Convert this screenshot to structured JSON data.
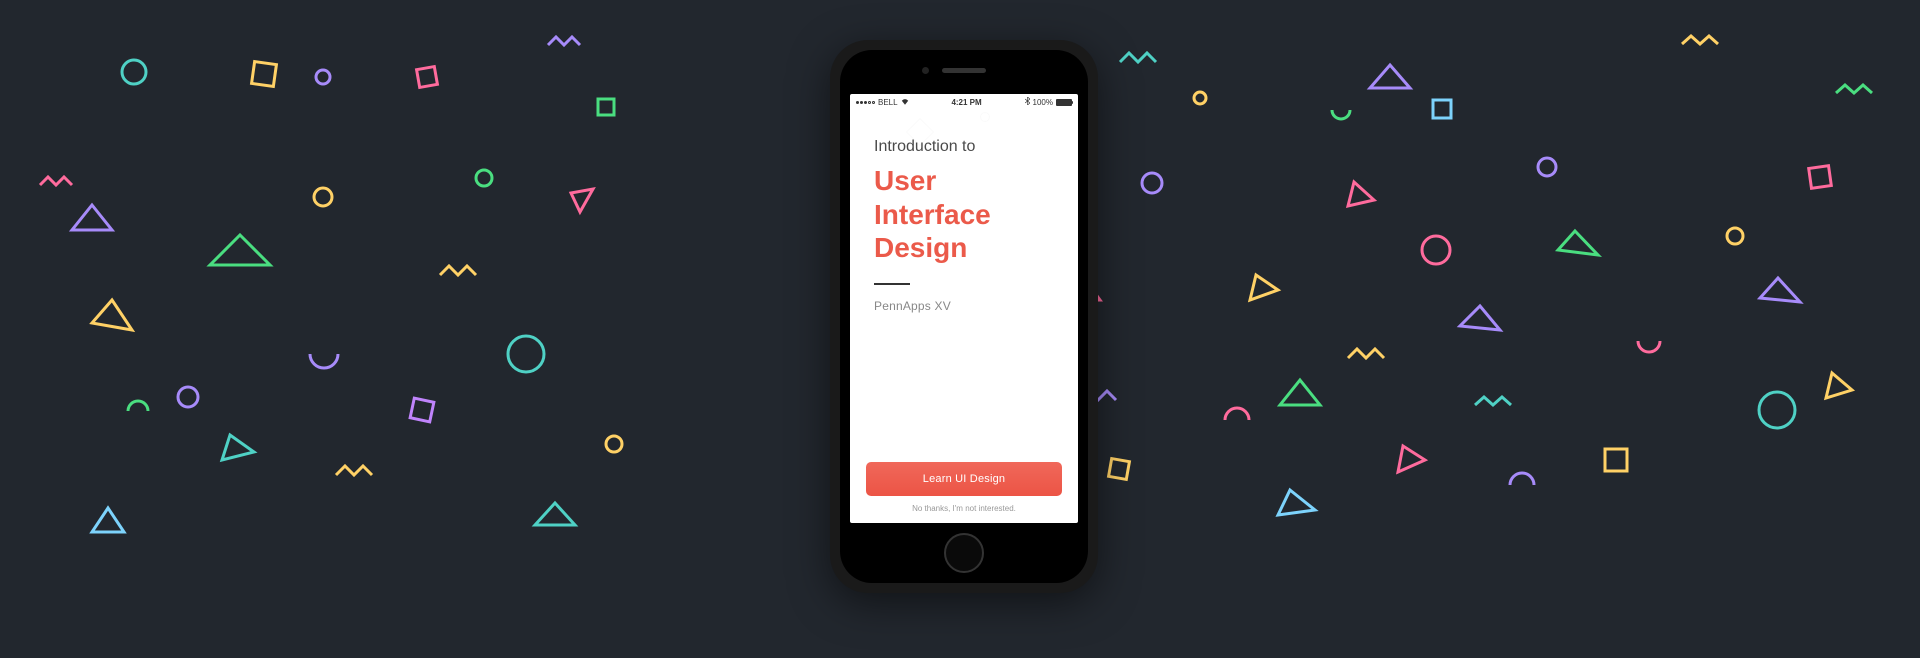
{
  "status_bar": {
    "carrier": "BELL",
    "time": "4:21 PM",
    "battery": "100%"
  },
  "intro_label": "Introduction to",
  "title_line1": "User",
  "title_line2": "Interface",
  "title_line3": "Design",
  "subtitle": "PennApps XV",
  "cta_label": "Learn UI Design",
  "secondary_label": "No thanks, I'm not interested.",
  "colors": {
    "bg": "#22272e",
    "accent": "#eb5a4a"
  }
}
